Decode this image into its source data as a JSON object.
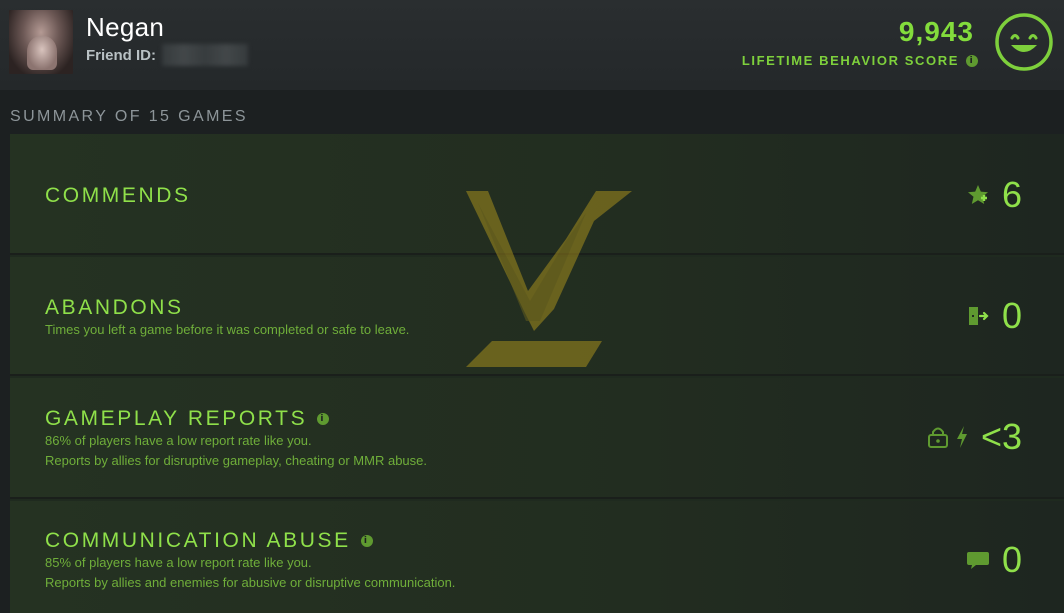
{
  "header": {
    "username": "Negan",
    "friend_id_label": "Friend ID:",
    "score": "9,943",
    "score_label": "LIFETIME BEHAVIOR SCORE",
    "info_glyph": "i",
    "avatar_icon": "user-avatar",
    "mood_icon": "smiley-face-icon"
  },
  "summary": {
    "title": "SUMMARY OF 15 GAMES"
  },
  "rows": [
    {
      "title": "COMMENDS",
      "value": "6",
      "icon": "star-icon"
    },
    {
      "title": "ABANDONS",
      "desc1": "Times you left a game before it was completed or safe to leave.",
      "value": "0",
      "icon": "exit-door-icon"
    },
    {
      "title": "GAMEPLAY REPORTS",
      "desc1": "86% of players have a low report rate like you.",
      "desc2": "Reports by allies for disruptive gameplay, cheating or MMR abuse.",
      "value": "<3",
      "icon": "lock-lightning-icon"
    },
    {
      "title": "COMMUNICATION ABUSE",
      "desc1": "85% of players have a low report rate like you.",
      "desc2": "Reports by allies and enemies for abusive or disruptive communication.",
      "value": "0",
      "icon": "speech-bubble-icon"
    }
  ],
  "colors": {
    "accent": "#8fe04a",
    "background": "#1c2021",
    "row_background": "#253222"
  }
}
